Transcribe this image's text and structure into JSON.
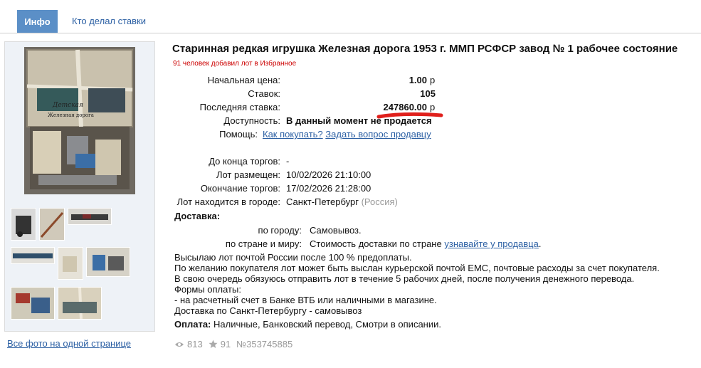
{
  "tabs": {
    "active": "Инфо",
    "other": "Кто делал ставки"
  },
  "lot": {
    "title": "Старинная редкая игрушка Железная дорога 1953 г. ММП РСФСР завод № 1 рабочее состояние",
    "favorites_note": "91 человек добавил лот в Избранное"
  },
  "bid": {
    "start_label": "Начальная цена:",
    "start_value": "1.00",
    "start_cur": "р",
    "bids_label": "Ставок:",
    "bids_value": "105",
    "last_label": "Последняя ставка:",
    "last_value": "247860.00",
    "last_cur": "р",
    "avail_label": "Доступность:",
    "avail_value": "В данный момент не продается",
    "help_label": "Помощь:",
    "help_link1": "Как покупать?",
    "help_link2": "Задать вопрос продавцу"
  },
  "timing": {
    "end_label": "До конца торгов:",
    "end_value": "-",
    "placed_label": "Лот размещен:",
    "placed_value": "10/02/2026 21:10:00",
    "close_label": "Окончание торгов:",
    "close_value": "17/02/2026 21:28:00",
    "city_label": "Лот находится в городе:",
    "city_value": "Санкт-Петербург",
    "country": "(Россия)"
  },
  "delivery": {
    "heading": "Доставка:",
    "city_label": "по городу:",
    "city_value": "Самовывоз.",
    "country_label": "по стране и миру:",
    "country_value": "Стоимость доставки по стране",
    "country_link": "узнавайте у продавца",
    "country_dot": "."
  },
  "description": [
    "Высылаю лот почтой России после 100 % предоплаты.",
    "По желанию покупателя лот может быть выслан курьерской почтой ЕМС, почтовые расходы за счет покупателя.",
    "В свою очередь обязуюсь отправить лот в течение 5 рабочих дней, после получения денежного перевода.",
    "Формы оплаты:",
    "- на расчетный счет в Банке ВТБ или наличными в магазине.",
    "Доставка по Санкт-Петербургу - самовывоз"
  ],
  "payment": {
    "label": "Оплата:",
    "value": "Наличные, Банковский перевод, Смотри в описании."
  },
  "stats": {
    "views": "813",
    "stars": "91",
    "lot_no": "№353745885"
  },
  "gallery": {
    "all_photos": "Все фото на одной странице",
    "box_label_1": "Детская",
    "box_label_2": "Железная дорога"
  },
  "colors": {
    "tab_active": "#5b8fc7",
    "link": "#2b5fa3",
    "fav_note": "#cc0000",
    "underline": "#e0201c"
  }
}
